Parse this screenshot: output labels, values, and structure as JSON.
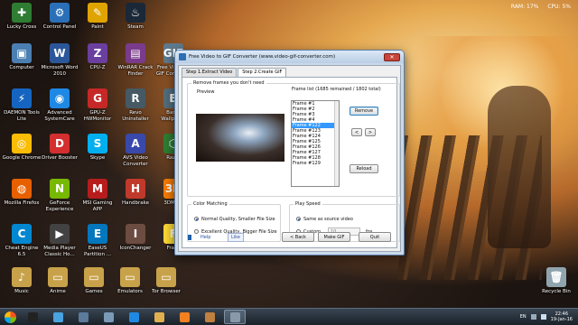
{
  "sysmon": {
    "ram": "RAM: 17%",
    "cpu": "CPU: 5%"
  },
  "desktop_icons": [
    {
      "label": "Lucky Cross",
      "color": "#2e7d32",
      "glyph": "✚"
    },
    {
      "label": "Control Panel",
      "color": "#2a6fb8",
      "glyph": "⚙"
    },
    {
      "label": "Paint",
      "color": "#e0a400",
      "glyph": "✎"
    },
    {
      "label": "Steam",
      "color": "#1b2838",
      "glyph": "♨"
    },
    {
      "label": "Computer",
      "color": "#4b7fb2",
      "glyph": "▣"
    },
    {
      "label": "Microsoft Word 2010",
      "color": "#2b579a",
      "glyph": "W"
    },
    {
      "label": "CPU-Z",
      "color": "#6a3fa0",
      "glyph": "Z"
    },
    {
      "label": "WinRAR Crack Finder",
      "color": "#7a3b8c",
      "glyph": "▤"
    },
    {
      "label": "Free Video to GIF Converter",
      "color": "#5f7a8e",
      "glyph": "GIF"
    },
    {
      "label": "DAEMON Tools Lite",
      "color": "#1565c0",
      "glyph": "⚡"
    },
    {
      "label": "Advanced SystemCare",
      "color": "#1e88e5",
      "glyph": "◉"
    },
    {
      "label": "GPU-Z HWMonitor",
      "color": "#c62828",
      "glyph": "G"
    },
    {
      "label": "Revo Uninstaller",
      "color": "#455a64",
      "glyph": "R"
    },
    {
      "label": "Bandi Wallpaper",
      "color": "#546e7a",
      "glyph": "B"
    },
    {
      "label": "Google Chrome",
      "color": "#fbbc05",
      "glyph": "◎"
    },
    {
      "label": "Driver Booster",
      "color": "#d32f2f",
      "glyph": "D"
    },
    {
      "label": "Skype",
      "color": "#00aff0",
      "glyph": "S"
    },
    {
      "label": "AVS Video Converter",
      "color": "#3949ab",
      "glyph": "A"
    },
    {
      "label": "Razer",
      "color": "#2e7d32",
      "glyph": "⬡"
    },
    {
      "label": "Mozilla Firefox",
      "color": "#e66000",
      "glyph": "◍"
    },
    {
      "label": "GeForce Experience",
      "color": "#76b900",
      "glyph": "N"
    },
    {
      "label": "MSI Gaming APP",
      "color": "#b71c1c",
      "glyph": "M"
    },
    {
      "label": "Handbrake",
      "color": "#c0392b",
      "glyph": "H"
    },
    {
      "label": "3DMark",
      "color": "#f57c00",
      "glyph": "3D"
    },
    {
      "label": "Cheat Engine 6.5",
      "color": "#0288d1",
      "glyph": "C"
    },
    {
      "label": "Media Player Classic Ho...",
      "color": "#424242",
      "glyph": "▶"
    },
    {
      "label": "EaseUS Partition ...",
      "color": "#0277bd",
      "glyph": "E"
    },
    {
      "label": "IconChanger",
      "color": "#6d4c41",
      "glyph": "I"
    },
    {
      "label": "Fraps",
      "color": "#fdd835",
      "glyph": "F"
    },
    {
      "label": "Music",
      "color": "#c8a24a",
      "glyph": "♪"
    },
    {
      "label": "Anime",
      "color": "#c8a24a",
      "glyph": "▭"
    },
    {
      "label": "Games",
      "color": "#c8a24a",
      "glyph": "▭"
    },
    {
      "label": "Emulators",
      "color": "#c8a24a",
      "glyph": "▭"
    },
    {
      "label": "Tor Browser",
      "color": "#c8a24a",
      "glyph": "▭"
    },
    {
      "label": "Recycle Bin",
      "color": "#90a4ae",
      "glyph": "🗑"
    }
  ],
  "window": {
    "title": "Free Video to GIF Converter (www.video-gif-converter.com)",
    "close": "✕",
    "tabs": [
      "Step 1.Extract Video",
      "Step 2.Create GIF"
    ],
    "remove_group_label": "Remove frames you don't need",
    "preview_label": "Preview",
    "frame_list_label": "Frame list (1685 remained / 1802 total)",
    "frames": [
      "Frame #1",
      "Frame #2",
      "Frame #3",
      "Frame #4",
      "Frame #122",
      "Frame #123",
      "Frame #124",
      "Frame #125",
      "Frame #126",
      "Frame #127",
      "Frame #128",
      "Frame #129"
    ],
    "selected_index": 4,
    "remove_btn": "Remove",
    "prev_btn": "<",
    "next_btn": ">",
    "reload_btn": "Reload",
    "color_group_label": "Color Matching",
    "color_options": [
      "Normal Quality, Smaller File Size",
      "Excellent Quality, Bigger File Size"
    ],
    "color_selected": 0,
    "speed_group_label": "Play Speed",
    "speed_options": [
      "Same as source video",
      "Custom"
    ],
    "speed_selected": 0,
    "fps_value": "10",
    "fps_unit": "fps",
    "help": "Help",
    "like": "Like",
    "back_btn": "< Back",
    "make_btn": "Make GIF",
    "quit_btn": "Quit"
  },
  "taskbar": {
    "items": [
      {
        "name": "cmd-icon",
        "color": "#222"
      },
      {
        "name": "network-icon",
        "color": "#4aa3df"
      },
      {
        "name": "monitor-icon",
        "color": "#5c7a9a"
      },
      {
        "name": "photo-icon",
        "color": "#7a9ab8"
      },
      {
        "name": "ie-icon",
        "color": "#1e88e5"
      },
      {
        "name": "explorer-icon",
        "color": "#e0b050"
      },
      {
        "name": "media-player-icon",
        "color": "#f08020"
      },
      {
        "name": "archive-icon",
        "color": "#c08040"
      },
      {
        "name": "gif-converter-icon",
        "color": "#8899aa"
      }
    ],
    "active_index": 8,
    "lang": "EN",
    "time": "22:46",
    "date": "19-Jan-16"
  }
}
